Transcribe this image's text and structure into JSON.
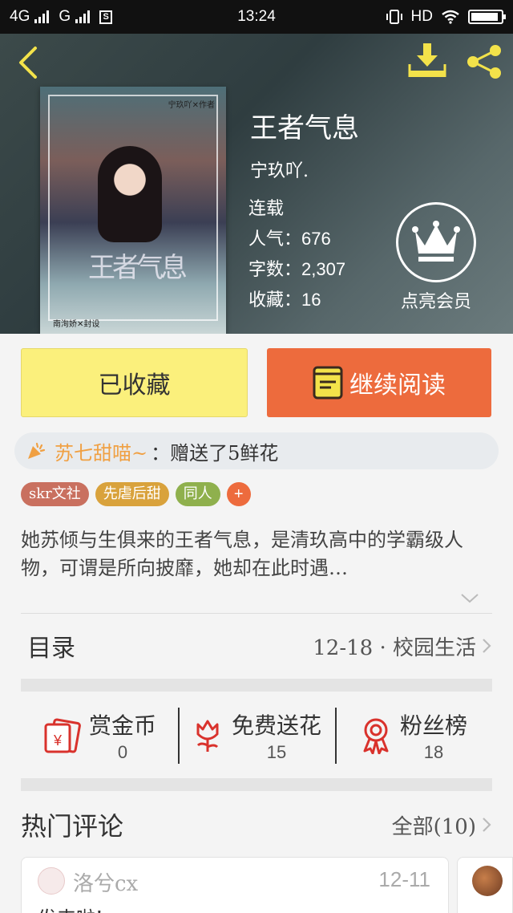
{
  "status_bar": {
    "network_1": "4G",
    "network_2": "G",
    "time": "13:24",
    "hd_label": "HD"
  },
  "book": {
    "title": "王者气息",
    "author": "宁玖吖.",
    "status": "连载",
    "stats": [
      {
        "label": "人气：",
        "value": "676"
      },
      {
        "label": "字数：",
        "value": "2,307"
      },
      {
        "label": "收藏：",
        "value": "16"
      }
    ],
    "cover_caption_top": "宁玖吖✕作者",
    "cover_caption_bottom": "南洵娇✕封设",
    "cover_title_art": "王者气息"
  },
  "vip": {
    "label": "点亮会员"
  },
  "actions": {
    "collected_label": "已收藏",
    "read_label": "继续阅读"
  },
  "gift": {
    "user": "苏七甜喵~",
    "text": "：赠送了5鲜花"
  },
  "tags": [
    {
      "label": "skr文社",
      "color": "#c9705f"
    },
    {
      "label": "先虐后甜",
      "color": "#d9a23c"
    },
    {
      "label": "同人",
      "color": "#8fb04d"
    }
  ],
  "tag_add_label": "+",
  "synopsis": "她苏倾与生俱来的王者气息，是清玖高中的学霸级人物，可谓是所向披靡，她却在此时遇…",
  "toc": {
    "title": "目录",
    "latest": "12-18 · 校园生活"
  },
  "stats_bar": [
    {
      "label": "赏金币",
      "value": "0",
      "icon": "red-envelope-icon"
    },
    {
      "label": "免费送花",
      "value": "15",
      "icon": "flower-icon"
    },
    {
      "label": "粉丝榜",
      "value": "18",
      "icon": "award-ribbon-icon"
    }
  ],
  "comments": {
    "title": "热门评论",
    "all_label": "全部(10)",
    "items": [
      {
        "user": "洛兮cx",
        "date": "12-11",
        "text": "发来啦!"
      }
    ]
  },
  "colors": {
    "accent_orange": "#ed6b3d",
    "collected_yellow": "#fbf07c",
    "icon_yellow": "#f3e24a",
    "icon_red": "#d9322c"
  }
}
